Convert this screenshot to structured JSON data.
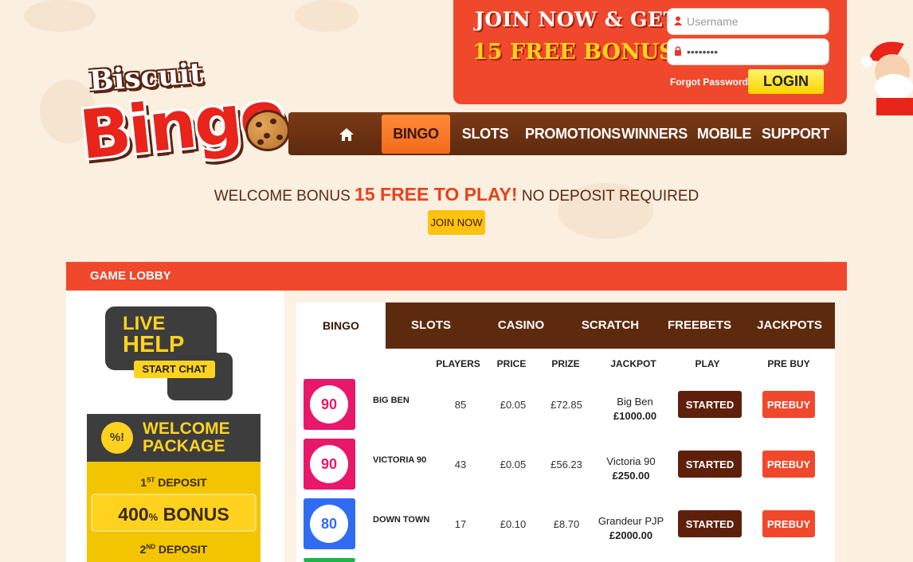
{
  "signup": {
    "headline_1": "JOIN NOW & GET",
    "headline_2": "15 FREE BONUS",
    "username_placeholder": "Username",
    "password_value": "••••••••",
    "forgot_label": "Forgot Password?",
    "login_label": "LOGIN"
  },
  "logo": {
    "word1": "Biscuit",
    "word2": "Bingo"
  },
  "nav": {
    "home_icon": "home-icon",
    "items": [
      "BINGO",
      "SLOTS",
      "PROMOTIONS",
      "WINNERS",
      "MOBILE",
      "SUPPORT"
    ],
    "active": "BINGO"
  },
  "welcome": {
    "prefix": "WELCOME BONUS",
    "highlight": "15 FREE TO PLAY!",
    "suffix": "NO DEPOSIT REQUIRED",
    "join_label": "JOIN NOW"
  },
  "lobby": {
    "title": "GAME LOBBY",
    "live_help": {
      "line1": "LIVE",
      "line2": "HELP",
      "button": "START CHAT"
    },
    "welcome_package": {
      "badge": "%!",
      "title_1": "WELCOME",
      "title_2": "PACKAGE",
      "deposit_1": {
        "num": "1",
        "sup": "ST",
        "label": "DEPOSIT"
      },
      "bonus_1": {
        "value": "400",
        "unit": "%",
        "label": "BONUS"
      },
      "deposit_2": {
        "num": "2",
        "sup": "ND",
        "label": "DEPOSIT"
      }
    },
    "tabs": [
      "BINGO",
      "SLOTS",
      "CASINO",
      "SCRATCH",
      "FREEBETS",
      "JACKPOTS"
    ],
    "active_tab": "BINGO",
    "columns": [
      "PLAYERS",
      "PRICE",
      "PRIZE",
      "JACKPOT",
      "PLAY",
      "PRE BUY"
    ],
    "rows": [
      {
        "ball": "90",
        "color": "#e8176a",
        "name": "BIG BEN",
        "players": "85",
        "price": "£0.05",
        "prize": "£72.85",
        "jackpot_name": "Big Ben",
        "jackpot_value": "£1000.00",
        "play": "STARTED",
        "prebuy": "PREBUY"
      },
      {
        "ball": "90",
        "color": "#e8176a",
        "name": "VICTORIA 90",
        "players": "43",
        "price": "£0.05",
        "prize": "£56.23",
        "jackpot_name": "Victoria 90",
        "jackpot_value": "£250.00",
        "play": "STARTED",
        "prebuy": "PREBUY"
      },
      {
        "ball": "80",
        "color": "#2f6cf2",
        "name": "DOWN TOWN",
        "players": "17",
        "price": "£0.10",
        "prize": "£8.70",
        "jackpot_name": "Grandeur PJP",
        "jackpot_value": "£2000.00",
        "play": "STARTED",
        "prebuy": "PREBUY"
      }
    ]
  },
  "colors": {
    "brand_orange": "#f0482c",
    "nav_brown": "#5e2a0e",
    "accent_yellow": "#ffd21f",
    "background": "#fbefdf"
  }
}
